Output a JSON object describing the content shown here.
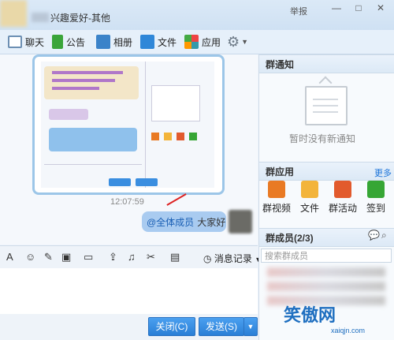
{
  "window": {
    "title": "兴趣爱好-其他",
    "report": "举报",
    "controls": [
      "—",
      "□",
      "✕"
    ]
  },
  "toolbar": {
    "items": [
      {
        "label": "聊天",
        "icon": "chat-icon"
      },
      {
        "label": "公告",
        "icon": "flag-icon"
      },
      {
        "label": "相册",
        "icon": "photo-icon"
      },
      {
        "label": "文件",
        "icon": "folder-icon"
      },
      {
        "label": "应用",
        "icon": "apps-icon"
      }
    ],
    "settings_icon": "gear-icon"
  },
  "chat": {
    "time": "12:07:59",
    "message_mention": "@全体成员",
    "message_text": "大家好"
  },
  "input_toolbar": {
    "history_label": "消息记录"
  },
  "buttons": {
    "close": "关闭(C)",
    "send": "发送(S)",
    "send_more": "▼"
  },
  "right_panel": {
    "notice_title": "群通知",
    "notice_empty": "暂时没有新通知",
    "apps_title": "群应用",
    "apps_more": "更多",
    "apps": [
      {
        "label": "群视频",
        "color": "#e97a24"
      },
      {
        "label": "文件",
        "color": "#f3b43a"
      },
      {
        "label": "群活动",
        "color": "#e25a2d"
      },
      {
        "label": "签到",
        "color": "#36a635"
      }
    ],
    "members_title": "群成员(2/3)",
    "search_placeholder": "搜索群成员"
  },
  "watermark": {
    "text": "笑傲网",
    "url": "xaiqjn.com"
  },
  "colors": {
    "accent": "#2a7fd6",
    "bubble": "#a9cbf0",
    "border": "#9cc6e8"
  }
}
